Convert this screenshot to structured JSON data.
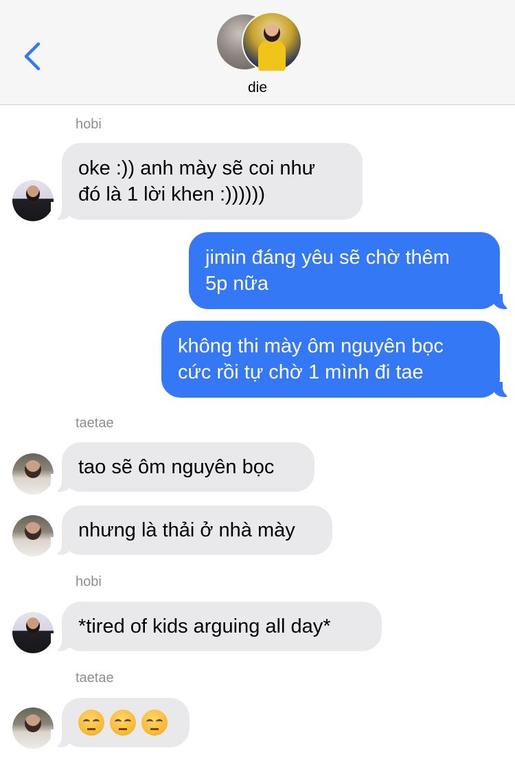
{
  "header": {
    "back_icon": "chevron-left-icon",
    "group_name": "die"
  },
  "colors": {
    "outgoing_bubble": "#3478f6",
    "incoming_bubble": "#e9e9eb",
    "accent": "#3478f6"
  },
  "messages": [
    {
      "kind": "sender",
      "text": "hobi"
    },
    {
      "kind": "in",
      "sender": "hobi",
      "text": "oke :)) anh mày sẽ coi như\nđó là 1 lời khen :))))))"
    },
    {
      "kind": "out",
      "text": "jimin đáng yêu sẽ chờ thêm\n5p nữa"
    },
    {
      "kind": "out",
      "text": "không thi mày ôm nguyên bọc\ncức rồi tự chờ 1 mình đi tae"
    },
    {
      "kind": "sender",
      "text": "taetae"
    },
    {
      "kind": "in",
      "sender": "taetae",
      "text": "tao sẽ ôm nguyên bọc"
    },
    {
      "kind": "in",
      "sender": "taetae",
      "text": "nhưng là thải ở nhà mày"
    },
    {
      "kind": "sender",
      "text": "hobi"
    },
    {
      "kind": "in",
      "sender": "hobi",
      "text": "*tired of kids arguing all day*"
    },
    {
      "kind": "sender",
      "text": "taetae"
    },
    {
      "kind": "in",
      "sender": "taetae",
      "emoji": [
        "pensive-face",
        "pensive-face",
        "pensive-face"
      ]
    }
  ]
}
